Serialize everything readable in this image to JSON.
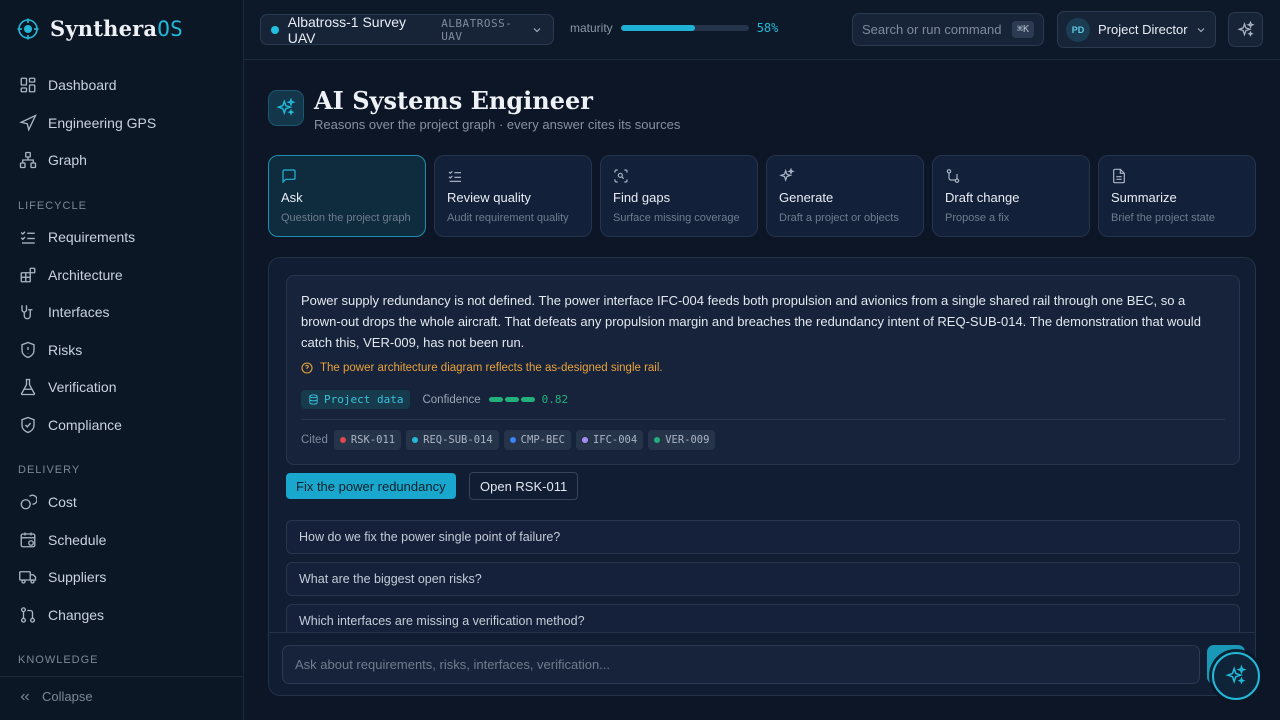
{
  "brand": {
    "name": "Synthera",
    "suffix": "OS"
  },
  "nav": {
    "top": [
      {
        "label": "Dashboard",
        "icon": "dashboard-icon"
      },
      {
        "label": "Engineering GPS",
        "icon": "navigation-icon"
      },
      {
        "label": "Graph",
        "icon": "graph-icon"
      }
    ],
    "sections": [
      {
        "title": "LIFECYCLE",
        "items": [
          {
            "label": "Requirements",
            "icon": "checklist-icon"
          },
          {
            "label": "Architecture",
            "icon": "architecture-icon"
          },
          {
            "label": "Interfaces",
            "icon": "plug-icon"
          },
          {
            "label": "Risks",
            "icon": "shield-alert-icon"
          },
          {
            "label": "Verification",
            "icon": "flask-icon"
          },
          {
            "label": "Compliance",
            "icon": "shield-check-icon"
          }
        ]
      },
      {
        "title": "DELIVERY",
        "items": [
          {
            "label": "Cost",
            "icon": "coins-icon"
          },
          {
            "label": "Schedule",
            "icon": "calendar-icon"
          },
          {
            "label": "Suppliers",
            "icon": "truck-icon"
          },
          {
            "label": "Changes",
            "icon": "git-pull-request-icon"
          }
        ]
      },
      {
        "title": "KNOWLEDGE",
        "items": []
      }
    ],
    "collapse_label": "Collapse"
  },
  "topbar": {
    "project_name": "Albatross-1 Survey UAV",
    "project_code": "ALBATROSS-UAV",
    "maturity_label": "maturity",
    "maturity_value": "58%",
    "maturity_fraction": 0.58,
    "search_placeholder": "Search or run command",
    "search_shortcut": "⌘K",
    "role_initials": "PD",
    "role_name": "Project Director"
  },
  "page": {
    "title": "AI Systems Engineer",
    "subtitle": "Reasons over the project graph · every answer cites its sources"
  },
  "modes": [
    {
      "title": "Ask",
      "desc": "Question the project graph",
      "icon": "message-icon",
      "active": true
    },
    {
      "title": "Review quality",
      "desc": "Audit requirement quality",
      "icon": "list-check-icon",
      "active": false
    },
    {
      "title": "Find gaps",
      "desc": "Surface missing coverage",
      "icon": "scan-search-icon",
      "active": false
    },
    {
      "title": "Generate",
      "desc": "Draft a project or objects",
      "icon": "sparkles-icon",
      "active": false
    },
    {
      "title": "Draft change",
      "desc": "Propose a fix",
      "icon": "git-compare-icon",
      "active": false
    },
    {
      "title": "Summarize",
      "desc": "Brief the project state",
      "icon": "file-text-icon",
      "active": false
    }
  ],
  "answer": {
    "text": "Power supply redundancy is not defined. The power interface IFC-004 feeds both propulsion and avionics from a single shared rail through one BEC, so a brown-out drops the whole aircraft. That defeats any propulsion margin and breaches the redundancy intent of REQ-SUB-014. The demonstration that would catch this, VER-009, has not been run.",
    "warning": "The power architecture diagram reflects the as-designed single rail.",
    "source_label": "Project data",
    "confidence_label": "Confidence",
    "confidence_value": "0.82",
    "confidence_fraction": 0.82,
    "cited_label": "Cited",
    "citations": [
      {
        "id": "RSK-011",
        "color": "#e0474f"
      },
      {
        "id": "REQ-SUB-014",
        "color": "#22b8d8"
      },
      {
        "id": "CMP-BEC",
        "color": "#3b82f6"
      },
      {
        "id": "IFC-004",
        "color": "#a78bfa"
      },
      {
        "id": "VER-009",
        "color": "#22b07a"
      }
    ]
  },
  "actions": {
    "primary": "Fix the power redundancy",
    "secondary": "Open RSK-011"
  },
  "suggestions": [
    "How do we fix the power single point of failure?",
    "What are the biggest open risks?",
    "Which interfaces are missing a verification method?"
  ],
  "chat": {
    "placeholder": "Ask about requirements, risks, interfaces, verification..."
  },
  "colors": {
    "accent": "#22b8d8",
    "warning": "#e8a23c",
    "success": "#22b07a",
    "background": "#0c1626"
  }
}
